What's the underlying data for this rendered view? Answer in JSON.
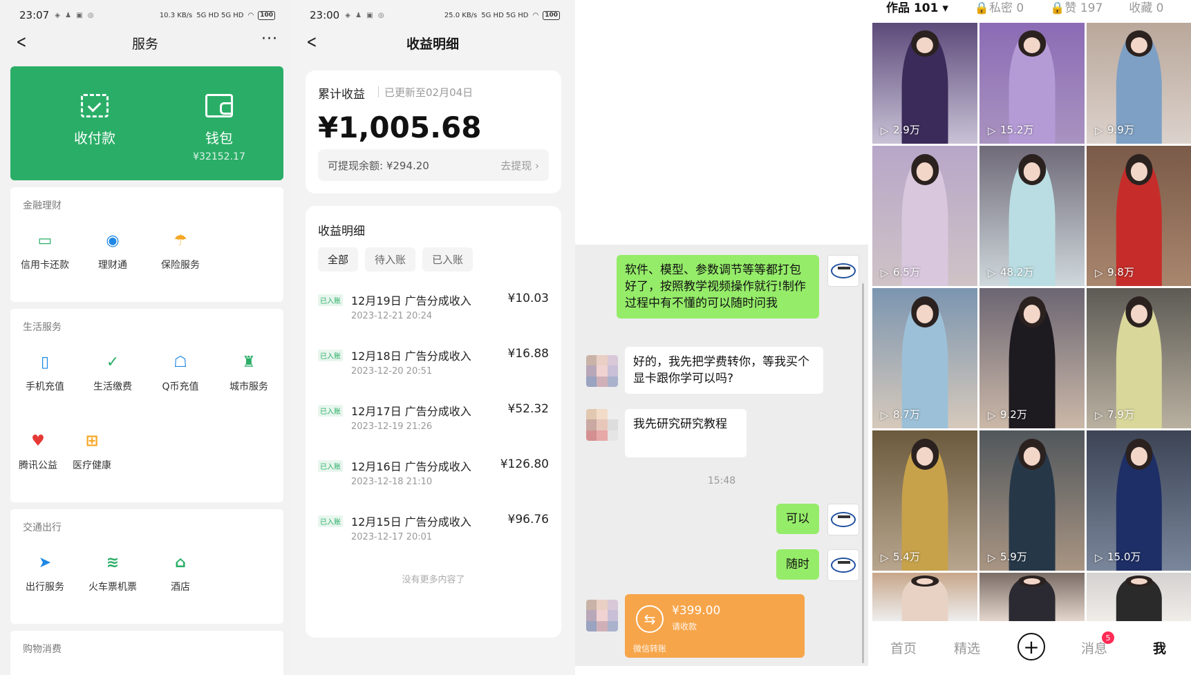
{
  "panel1": {
    "status": {
      "time": "23:07",
      "net": "10.3 KB/s",
      "signal": "5G HD 5G HD",
      "battery": "100"
    },
    "title": "服务",
    "green_card": {
      "pay_label": "收付款",
      "wallet_label": "钱包",
      "wallet_balance": "¥32152.17"
    },
    "sections": [
      {
        "title": "金融理财",
        "items": [
          "信用卡还款",
          "理财通",
          "保险服务"
        ]
      },
      {
        "title": "生活服务",
        "items": [
          "手机充值",
          "生活缴费",
          "Q币充值",
          "城市服务",
          "腾讯公益",
          "医疗健康"
        ]
      },
      {
        "title": "交通出行",
        "items": [
          "出行服务",
          "火车票机票",
          "酒店"
        ]
      },
      {
        "title": "购物消费"
      }
    ],
    "accent_color": "#2aae67"
  },
  "panel2": {
    "status": {
      "time": "23:00",
      "net": "25.0 KB/s",
      "signal": "5G HD 5G HD",
      "battery": "100"
    },
    "title": "收益明细",
    "cumulative_label": "累计收益",
    "updated": "已更新至02月04日",
    "amount": "¥1,005.68",
    "withdrawable": "可提现余额: ¥294.20",
    "withdraw_link": "去提现",
    "list_title": "收益明细",
    "filters": [
      "全部",
      "待入账",
      "已入账"
    ],
    "rows": [
      {
        "tag": "已入账",
        "title": "12月19日 广告分成收入",
        "date": "2023-12-21 20:24",
        "amount": "¥10.03"
      },
      {
        "tag": "已入账",
        "title": "12月18日 广告分成收入",
        "date": "2023-12-20 20:51",
        "amount": "¥16.88"
      },
      {
        "tag": "已入账",
        "title": "12月17日 广告分成收入",
        "date": "2023-12-19 21:26",
        "amount": "¥52.32"
      },
      {
        "tag": "已入账",
        "title": "12月16日 广告分成收入",
        "date": "2023-12-18 21:10",
        "amount": "¥126.80"
      },
      {
        "tag": "已入账",
        "title": "12月15日 广告分成收入",
        "date": "2023-12-17 20:01",
        "amount": "¥96.76"
      }
    ],
    "no_more": "没有更多内容了"
  },
  "panel3": {
    "messages": [
      {
        "from": "me",
        "text": "软件、模型、参数调节等等都打包好了，按照教学视频操作就行!制作过程中有不懂的可以随时问我"
      },
      {
        "from": "other",
        "text": "好的，我先把学费转你，等我买个显卡跟你学可以吗?"
      },
      {
        "from": "other",
        "text": "我先研究研究教程"
      },
      {
        "from": "me",
        "text": "可以"
      },
      {
        "from": "me",
        "text": "随时"
      }
    ],
    "time_divider": "15:48",
    "transfer": {
      "amount": "¥399.00",
      "note": "请收款",
      "footer": "微信转账"
    },
    "bubble_color": "#95ec69",
    "transfer_color": "#f7a54a"
  },
  "panel4": {
    "tabs": [
      "作品 101 ▾",
      "🔒私密 0",
      "🔒赞 197",
      "收藏 0"
    ],
    "views": [
      "2.9万",
      "15.2万",
      "9.9万",
      "6.5万",
      "48.2万",
      "9.8万",
      "8.7万",
      "9.2万",
      "7.9万",
      "5.4万",
      "5.9万",
      "15.0万"
    ],
    "nav": {
      "home": "首页",
      "featured": "精选",
      "plus": "+",
      "messages": "消息",
      "badge": "5",
      "me": "我"
    }
  }
}
